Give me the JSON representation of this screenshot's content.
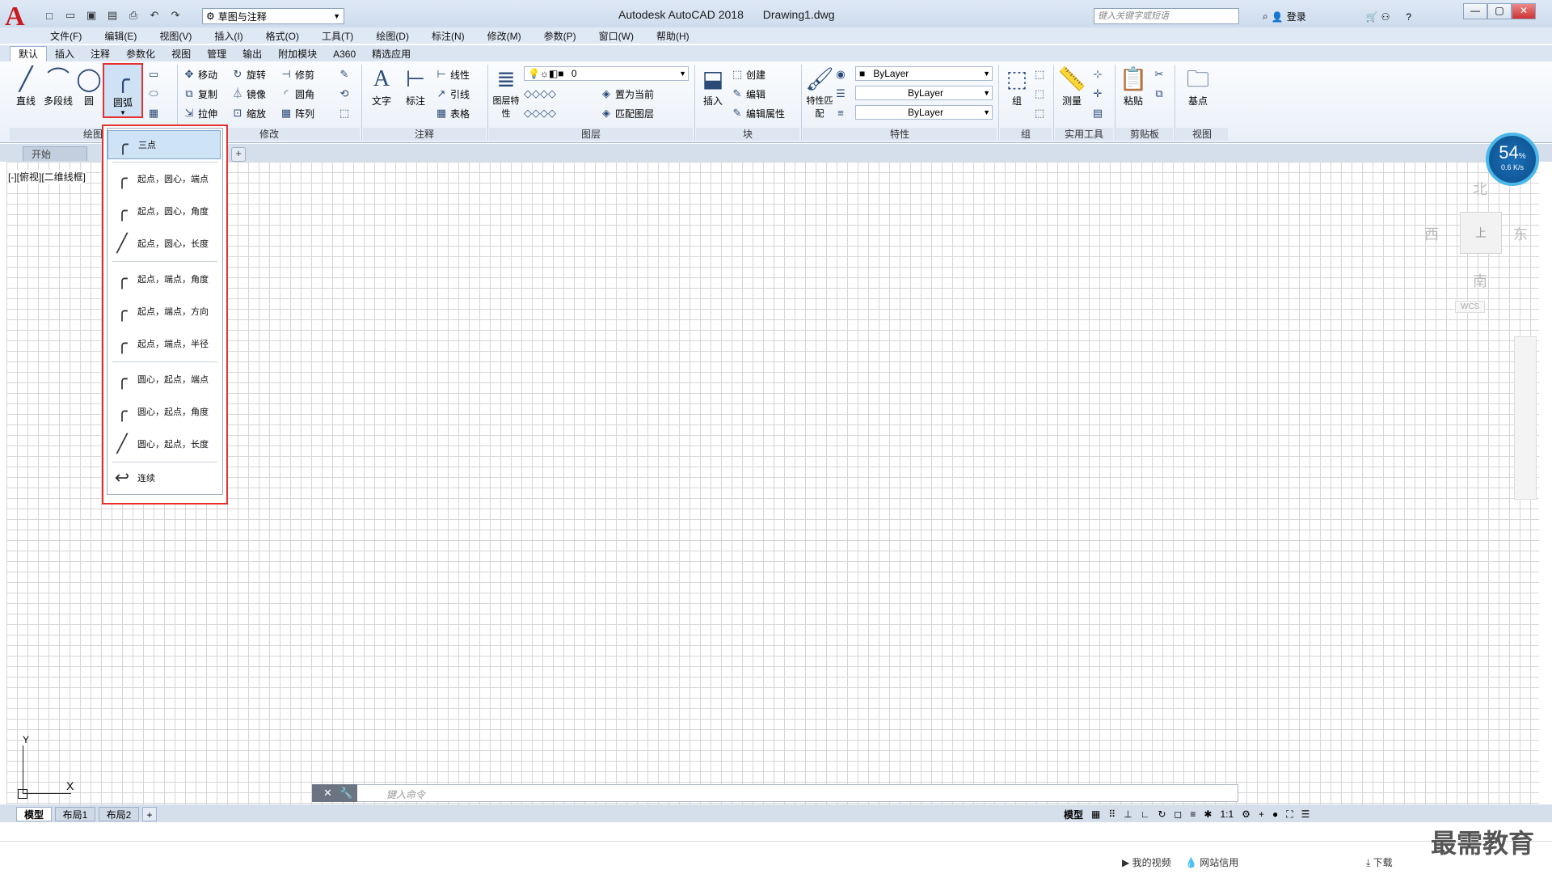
{
  "app": {
    "title": "Autodesk AutoCAD 2018",
    "file": "Drawing1.dwg",
    "logo_letter": "A",
    "workspace": "草图与注释",
    "search_placeholder": "键入关键字或短语",
    "signin": "登录"
  },
  "menu": [
    "文件(F)",
    "编辑(E)",
    "视图(V)",
    "插入(I)",
    "格式(O)",
    "工具(T)",
    "绘图(D)",
    "标注(N)",
    "修改(M)",
    "参数(P)",
    "窗口(W)",
    "帮助(H)"
  ],
  "ribbon_tabs": [
    "默认",
    "插入",
    "注释",
    "参数化",
    "视图",
    "管理",
    "输出",
    "附加模块",
    "A360",
    "精选应用"
  ],
  "ribbon": {
    "draw": {
      "line": "直线",
      "polyline": "多段线",
      "circle": "圆",
      "arc": "圆弧",
      "panel": "绘图"
    },
    "modify": {
      "move": "移动",
      "rotate": "旋转",
      "trim": "修剪",
      "copy": "复制",
      "mirror": "镜像",
      "fillet": "圆角",
      "stretch": "拉伸",
      "scale": "缩放",
      "array": "阵列",
      "panel": "修改"
    },
    "annotation": {
      "text": "文字",
      "dimension": "标注",
      "linear": "线性",
      "leader": "引线",
      "table": "表格",
      "panel": "注释"
    },
    "layers": {
      "props": "图层特性",
      "current_layer": "0",
      "set_current": "置为当前",
      "match": "匹配图层",
      "panel": "图层"
    },
    "block": {
      "insert": "插入",
      "create": "创建",
      "edit": "编辑",
      "edit_attr": "编辑属性",
      "panel": "块"
    },
    "properties": {
      "match": "特性匹配",
      "color": "ByLayer",
      "linetype": "ByLayer",
      "lineweight": "ByLayer",
      "panel": "特性"
    },
    "groups": {
      "group": "组",
      "panel": "组"
    },
    "utilities": {
      "measure": "测量",
      "panel": "实用工具"
    },
    "clipboard": {
      "paste": "粘贴",
      "panel": "剪贴板"
    },
    "view": {
      "base": "基点",
      "panel": "视图"
    }
  },
  "file_tabs": {
    "start": "开始"
  },
  "viewport_label": "[-][俯视][二维线框]",
  "arc_menu": [
    {
      "label": "三点",
      "selected": true
    },
    {
      "label": "起点，圆心，端点"
    },
    {
      "label": "起点，圆心，角度"
    },
    {
      "label": "起点，圆心，长度"
    },
    {
      "label": "起点，端点，角度"
    },
    {
      "label": "起点，端点，方向"
    },
    {
      "label": "起点，端点，半径"
    },
    {
      "label": "圆心，起点，端点"
    },
    {
      "label": "圆心，起点，角度"
    },
    {
      "label": "圆心，起点，长度"
    },
    {
      "label": "连续"
    }
  ],
  "viewcube": {
    "north": "北",
    "south": "南",
    "east": "东",
    "west": "西",
    "top": "上",
    "wcs": "WCS"
  },
  "net_badge": {
    "percent": "54",
    "unit": "%",
    "speed": "0.6 K/s"
  },
  "command": {
    "placeholder": "键入命令"
  },
  "layout_tabs": [
    "模型",
    "布局1",
    "布局2"
  ],
  "status": {
    "model": "模型",
    "scale": "1:1"
  },
  "ucs": {
    "x": "X",
    "y": "Y"
  },
  "tray": {
    "video": "我的视频",
    "credit": "网站信用",
    "download": "下载"
  },
  "watermark": "最需教育"
}
